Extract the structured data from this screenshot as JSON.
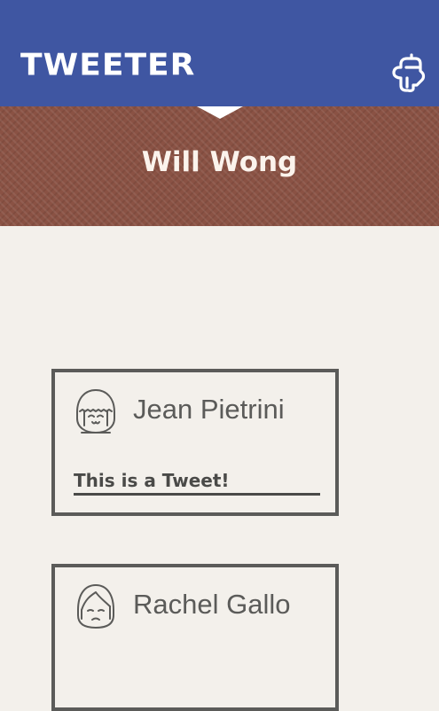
{
  "app": {
    "logo_text": "TWEETER",
    "menu_icon": "pointing-hand-icon"
  },
  "profile": {
    "name": "Will Wong"
  },
  "colors": {
    "header_bg": "#3f56a2",
    "banner_bg": "#8a5244",
    "page_bg": "#f3f0eb",
    "card_border": "#5b5b59"
  },
  "tweets": [
    {
      "author": "Jean Pietrini",
      "avatar_icon": "smiling-girl-avatar-icon",
      "text": "This is a Tweet!"
    },
    {
      "author": "Rachel Gallo",
      "avatar_icon": "sad-girl-avatar-icon",
      "text": ""
    }
  ]
}
